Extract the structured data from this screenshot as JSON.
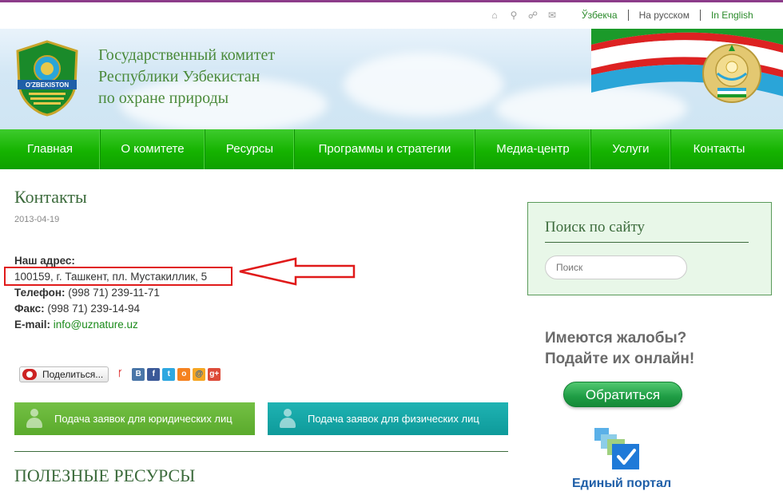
{
  "topbar": {
    "icons": [
      "home-icon",
      "search-icon",
      "sitemap-icon",
      "mail-icon"
    ],
    "languages": [
      {
        "label": "Ўзбекча"
      },
      {
        "label": "На русском"
      },
      {
        "label": "In English"
      }
    ]
  },
  "header": {
    "logo_text": "O'ZBEKISTON",
    "title_lines": [
      "Государственный комитет",
      "Республики Узбекистан",
      "по охране природы"
    ]
  },
  "nav": {
    "items": [
      "Главная",
      "О комитете",
      "Ресурсы",
      "Программы и стратегии",
      "Медиа-центр",
      "Услуги",
      "Контакты"
    ]
  },
  "main": {
    "title": "Контакты",
    "date": "2013-04-19",
    "address_label": "Наш адрес:",
    "address": "100159, г. Ташкент, пл. Мустакиллик, 5",
    "phone_label": "Телефон:",
    "phone": "(998 71) 239-11-71",
    "fax_label": "Факс:",
    "fax": "(998 71) 239-14-94",
    "email_label": "E-mail:",
    "email": "info@uznature.uz",
    "share_label": "Поделиться...",
    "request_legal": "Подача заявок для юридических лиц",
    "request_physical": "Подача заявок для физических лиц",
    "resources_title": "ПОЛЕЗНЫЕ РЕСУРСЫ"
  },
  "sidebar": {
    "search_title": "Поиск по сайту",
    "search_placeholder": "Поиск",
    "complaint_line1": "Имеются жалобы?",
    "complaint_line2": "Подайте их онлайн!",
    "apply_label": "Обратиться",
    "portal_label": "Единый портал"
  },
  "colors": {
    "nav_green": "#15b300",
    "text_green": "#3c6b3c",
    "annotation_red": "#e01a1a",
    "accent_purple": "#8c3b8a"
  }
}
